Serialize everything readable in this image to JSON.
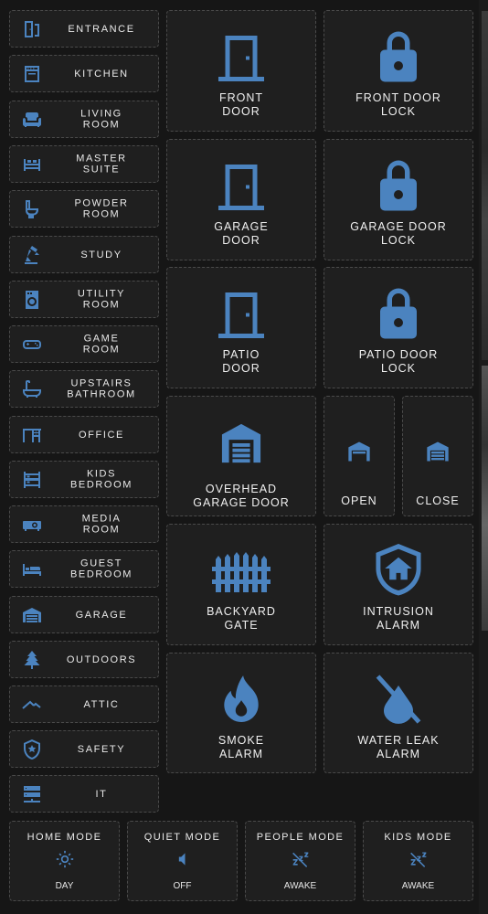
{
  "rooms": [
    {
      "label": "ENTRANCE",
      "icon": "door-entrance-icon"
    },
    {
      "label": "KITCHEN",
      "icon": "stove-icon"
    },
    {
      "label": "LIVING\nROOM",
      "icon": "sofa-icon"
    },
    {
      "label": "MASTER\nSUITE",
      "icon": "bed-icon"
    },
    {
      "label": "POWDER\nROOM",
      "icon": "toilet-icon"
    },
    {
      "label": "STUDY",
      "icon": "desk-lamp-icon"
    },
    {
      "label": "UTILITY\nROOM",
      "icon": "washing-machine-icon"
    },
    {
      "label": "GAME\nROOM",
      "icon": "gamepad-icon"
    },
    {
      "label": "UPSTAIRS\nBATHROOM",
      "icon": "bathtub-icon"
    },
    {
      "label": "OFFICE",
      "icon": "desk-icon"
    },
    {
      "label": "KIDS\nBEDROOM",
      "icon": "bunk-bed-icon"
    },
    {
      "label": "MEDIA\nROOM",
      "icon": "projector-icon"
    },
    {
      "label": "GUEST\nBEDROOM",
      "icon": "single-bed-icon"
    },
    {
      "label": "GARAGE",
      "icon": "garage-icon"
    },
    {
      "label": "OUTDOORS",
      "icon": "pine-tree-icon"
    },
    {
      "label": "ATTIC",
      "icon": "roof-icon"
    },
    {
      "label": "SAFETY",
      "icon": "security-shield-icon"
    },
    {
      "label": "IT",
      "icon": "server-icon"
    }
  ],
  "tiles": {
    "front_door": {
      "label": "FRONT\nDOOR",
      "icon": "door-closed-icon"
    },
    "front_door_lock": {
      "label": "FRONT DOOR\nLOCK",
      "icon": "lock-icon"
    },
    "garage_door": {
      "label": "GARAGE\nDOOR",
      "icon": "door-closed-icon"
    },
    "garage_door_lock": {
      "label": "GARAGE DOOR\nLOCK",
      "icon": "lock-icon"
    },
    "patio_door": {
      "label": "PATIO\nDOOR",
      "icon": "door-closed-icon"
    },
    "patio_door_lock": {
      "label": "PATIO DOOR\nLOCK",
      "icon": "lock-icon"
    },
    "overhead_garage_door": {
      "label": "OVERHEAD\nGARAGE DOOR",
      "icon": "garage-closed-icon"
    },
    "garage_open": {
      "label": "OPEN",
      "icon": "garage-open-icon"
    },
    "garage_close": {
      "label": "CLOSE",
      "icon": "garage-close-icon"
    },
    "backyard_gate": {
      "label": "BACKYARD\nGATE",
      "icon": "gate-icon"
    },
    "intrusion_alarm": {
      "label": "INTRUSION\nALARM",
      "icon": "shield-home-icon"
    },
    "smoke_alarm": {
      "label": "SMOKE\nALARM",
      "icon": "fire-icon"
    },
    "water_leak_alarm": {
      "label": "WATER LEAK\nALARM",
      "icon": "water-off-icon"
    }
  },
  "modes": [
    {
      "title": "HOME MODE",
      "value": "DAY",
      "icon": "sun-icon"
    },
    {
      "title": "QUIET MODE",
      "value": "OFF",
      "icon": "speaker-icon"
    },
    {
      "title": "PEOPLE MODE",
      "value": "AWAKE",
      "icon": "sleep-off-icon"
    },
    {
      "title": "KIDS MODE",
      "value": "AWAKE",
      "icon": "sleep-off-icon"
    }
  ],
  "colors": {
    "accent": "#4b83bf",
    "background": "#161616",
    "card": "#1f1f1f"
  }
}
